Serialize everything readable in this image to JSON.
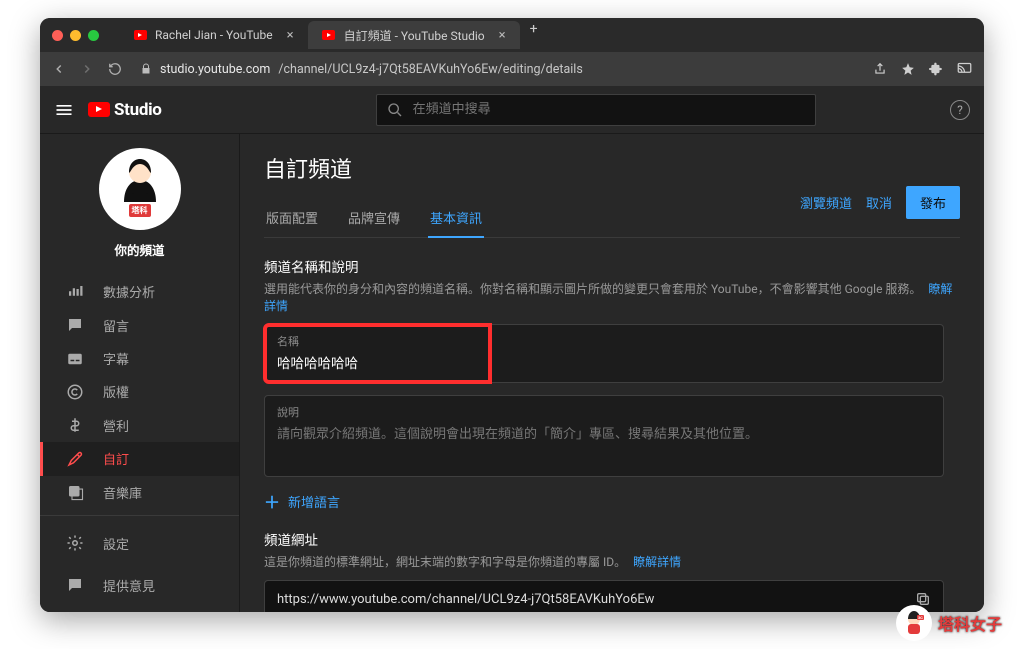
{
  "browser": {
    "tabs": [
      {
        "title": "Rachel Jian - YouTube",
        "active": false
      },
      {
        "title": "自訂頻道 - YouTube Studio",
        "active": true
      }
    ],
    "url_host": "studio.youtube.com",
    "url_path": "/channel/UCL9z4-j7Qt58EAVKuhYo6Ew/editing/details"
  },
  "header": {
    "brand": "Studio",
    "search_placeholder": "在頻道中搜尋"
  },
  "sidebar": {
    "channel_label": "你的頻道",
    "avatar_tag": "塔科",
    "items": [
      {
        "icon": "analytics-icon",
        "label": "數據分析"
      },
      {
        "icon": "comments-icon",
        "label": "留言"
      },
      {
        "icon": "subtitles-icon",
        "label": "字幕"
      },
      {
        "icon": "copyright-icon",
        "label": "版權"
      },
      {
        "icon": "monetize-icon",
        "label": "營利"
      },
      {
        "icon": "customize-icon",
        "label": "自訂"
      },
      {
        "icon": "audio-library-icon",
        "label": "音樂庫"
      }
    ],
    "bottom": [
      {
        "icon": "settings-icon",
        "label": "設定"
      },
      {
        "icon": "feedback-icon",
        "label": "提供意見"
      }
    ]
  },
  "main": {
    "title": "自訂頻道",
    "tabs": [
      {
        "label": "版面配置",
        "active": false
      },
      {
        "label": "品牌宣傳",
        "active": false
      },
      {
        "label": "基本資訊",
        "active": true
      }
    ],
    "actions": {
      "view": "瀏覽頻道",
      "cancel": "取消",
      "publish": "發布"
    },
    "name_section": {
      "heading": "頻道名稱和說明",
      "sub": "選用能代表你的身分和內容的頻道名稱。你對名稱和顯示圖片所做的變更只會套用於 YouTube，不會影響其他 Google 服務。",
      "learn_more": "瞭解詳情",
      "name_label": "名稱",
      "name_value": "哈哈哈哈哈哈",
      "desc_label": "說明",
      "desc_placeholder": "請向觀眾介紹頻道。這個說明會出現在頻道的「簡介」專區、搜尋結果及其他位置。"
    },
    "add_language": "新增語言",
    "url_section": {
      "heading": "頻道網址",
      "sub": "這是你頻道的標準網址，網址末端的數字和字母是你頻道的專屬 ID。",
      "learn_more": "瞭解詳情",
      "url": "https://www.youtube.com/channel/UCL9z4-j7Qt58EAVKuhYo6Ew"
    }
  },
  "watermark": "塔科女子"
}
